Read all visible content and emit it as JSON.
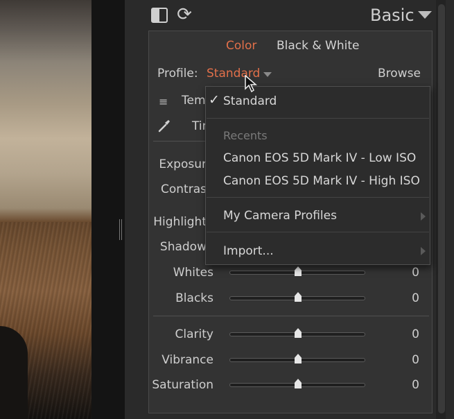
{
  "header": {
    "title": "Basic",
    "reset_icon_glyph": "⟳"
  },
  "tabs": {
    "color": "Color",
    "black_white": "Black & White"
  },
  "profile": {
    "label": "Profile:",
    "value": "Standard",
    "browse": "Browse"
  },
  "wb": {
    "temp_label": "Tem",
    "tint_label": "Tin",
    "lines_glyph": "≡"
  },
  "sliders_tone": [
    {
      "label": "Exposur",
      "value": ""
    },
    {
      "label": "Contras",
      "value": ""
    },
    {
      "label": "Highlight",
      "value": ""
    },
    {
      "label": "Shadow",
      "value": ""
    },
    {
      "label": "Whites",
      "value": "0"
    },
    {
      "label": "Blacks",
      "value": "0"
    }
  ],
  "sliders_presence": [
    {
      "label": "Clarity",
      "value": "0"
    },
    {
      "label": "Vibrance",
      "value": "0"
    },
    {
      "label": "Saturation",
      "value": "0"
    }
  ],
  "menu": {
    "check_glyph": "✓",
    "selected": "Standard",
    "recents_header": "Recents",
    "recent_items": [
      "Canon EOS 5D Mark IV - Low ISO",
      "Canon EOS 5D Mark IV - High ISO"
    ],
    "camera_profiles": "My Camera Profiles",
    "import": "Import..."
  },
  "colors": {
    "accent": "#e2704a",
    "panel": "#333333",
    "menu_bg": "#2c2c2c"
  }
}
